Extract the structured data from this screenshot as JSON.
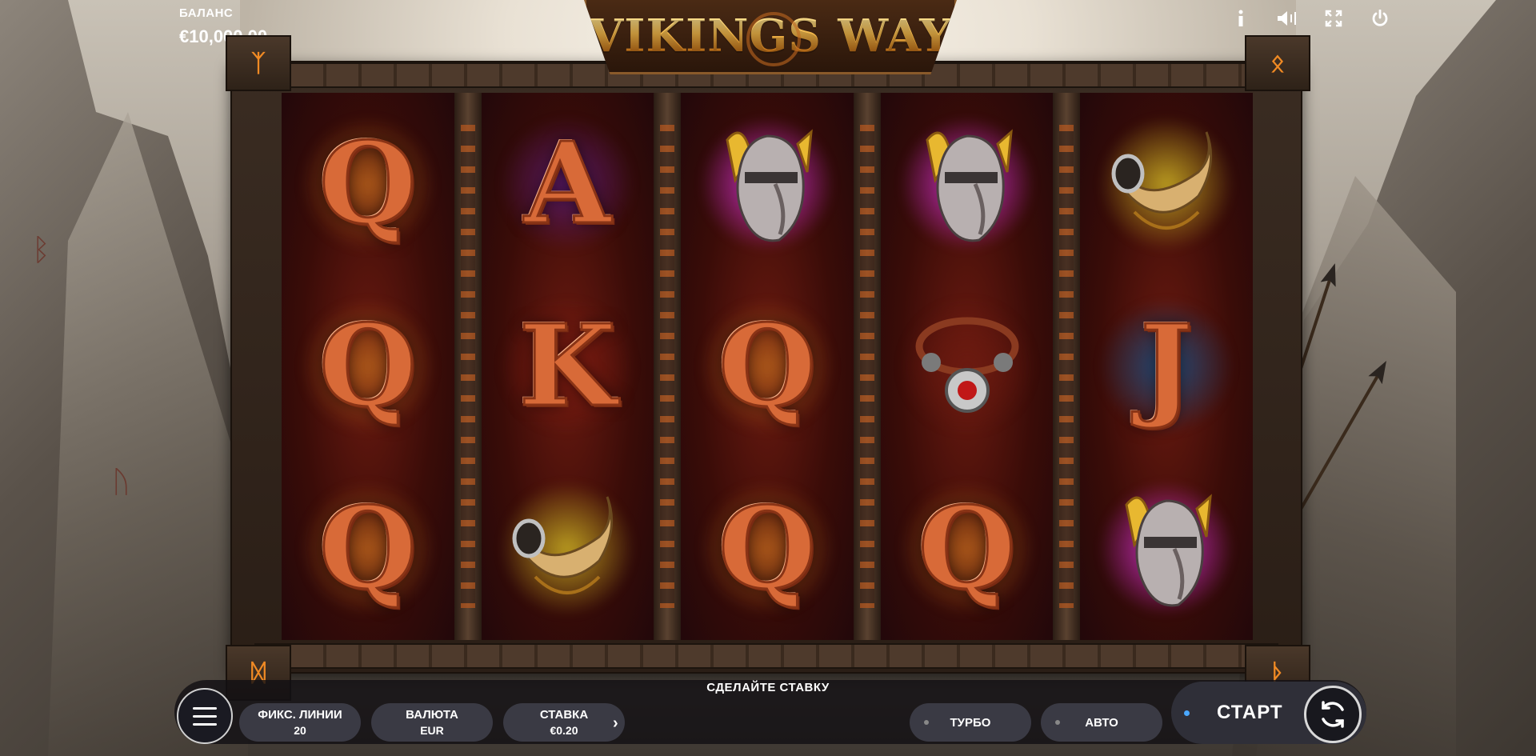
{
  "game": {
    "title": "VIKINGS WAY"
  },
  "balance": {
    "label": "БАЛАНС",
    "value": "€10,000.00"
  },
  "top_icons": [
    "info-icon",
    "sound-icon",
    "fullscreen-icon",
    "power-icon"
  ],
  "corners": {
    "top_left": "ᛉ",
    "top_right": "ᛟ",
    "bottom_left": "ᛞ",
    "bottom_right": "ᚦ"
  },
  "reels": [
    [
      "Q",
      "Q",
      "Q"
    ],
    [
      "A",
      "K",
      "horn"
    ],
    [
      "helmet",
      "Q",
      "Q"
    ],
    [
      "helmet",
      "necklace",
      "Q"
    ],
    [
      "horn",
      "J",
      "helmet"
    ]
  ],
  "symbol_glow": {
    "Q": "#a8561a",
    "A": "#5a1a6a",
    "K": "#7a1a10",
    "J": "#1a4a7a",
    "helmet": "#d030d0",
    "horn": "#b89a20",
    "necklace": "#6a1a10"
  },
  "status_message": "СДЕЛАЙТЕ СТАВКУ",
  "controls": {
    "lines": {
      "label": "ФИКС. ЛИНИИ",
      "value": "20"
    },
    "currency": {
      "label": "ВАЛЮТА",
      "value": "EUR"
    },
    "bet": {
      "label": "СТАВКА",
      "value": "€0.20"
    },
    "turbo": "ТУРБО",
    "auto": "АВТО",
    "start": "СТАРТ"
  }
}
